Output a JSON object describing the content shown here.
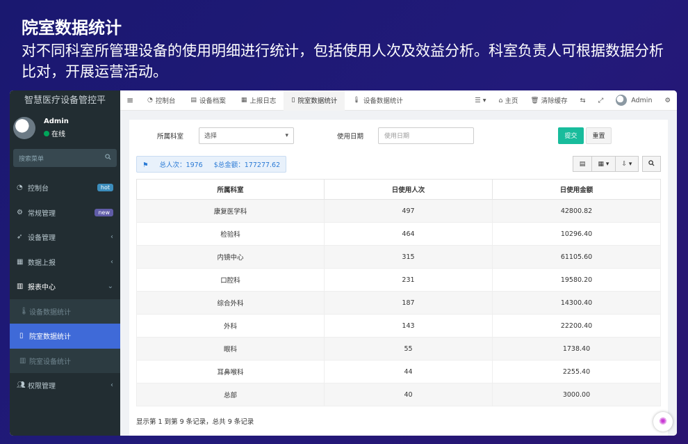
{
  "slide": {
    "title": "院室数据统计",
    "description": "对不同科室所管理设备的使用明细进行统计，包括使用人次及效益分析。科室负责人可根据数据分析比对，开展运营活动。"
  },
  "sidebar": {
    "brand": "智慧医疗设备管控平",
    "user": {
      "name": "Admin",
      "status": "在线"
    },
    "search_placeholder": "搜索菜单",
    "items": [
      {
        "label": "控制台",
        "icon": "dashboard-icon",
        "badge": "hot"
      },
      {
        "label": "常规管理",
        "icon": "cogs-icon",
        "badge": "new"
      },
      {
        "label": "设备管理",
        "icon": "rocket-icon"
      },
      {
        "label": "数据上报",
        "icon": "calendar-icon"
      },
      {
        "label": "报表中心",
        "icon": "bar-chart-icon"
      },
      {
        "label": "权限管理",
        "icon": "users-icon"
      }
    ],
    "sub_items": [
      {
        "label": "设备数据统计"
      },
      {
        "label": "院室数据统计"
      },
      {
        "label": "院室设备统计"
      }
    ]
  },
  "topbar": {
    "tabs": [
      {
        "label": "控制台"
      },
      {
        "label": "设备档案"
      },
      {
        "label": "上报日志"
      },
      {
        "label": "院室数据统计"
      },
      {
        "label": "设备数据统计"
      }
    ],
    "home": "主页",
    "clear_cache": "清除缓存",
    "user": "Admin"
  },
  "filters": {
    "dept_label": "所属科室",
    "dept_value": "选择",
    "date_label": "使用日期",
    "date_placeholder": "使用日期",
    "submit": "提交",
    "reset": "重置"
  },
  "summary": {
    "total_visits": "总人次：1976",
    "total_amount": "$总金额：177277.62"
  },
  "table": {
    "headers": [
      "所属科室",
      "日使用人次",
      "日使用金额"
    ],
    "rows": [
      [
        "康复医学科",
        "497",
        "42800.82"
      ],
      [
        "检验科",
        "464",
        "10296.40"
      ],
      [
        "内镜中心",
        "315",
        "61105.60"
      ],
      [
        "口腔科",
        "231",
        "19580.20"
      ],
      [
        "综合外科",
        "187",
        "14300.40"
      ],
      [
        "外科",
        "143",
        "22200.40"
      ],
      [
        "眼科",
        "55",
        "1738.40"
      ],
      [
        "耳鼻喉科",
        "44",
        "2255.40"
      ],
      [
        "总部",
        "40",
        "3000.00"
      ]
    ]
  },
  "pager": "显示第 1 到第 9 条记录，总共 9 条记录",
  "colors": {
    "sidebar_bg": "#222d32",
    "active_menu": "#3f6ad8",
    "submit_btn": "#18bc9c",
    "summary_text": "#2a7ad5"
  }
}
